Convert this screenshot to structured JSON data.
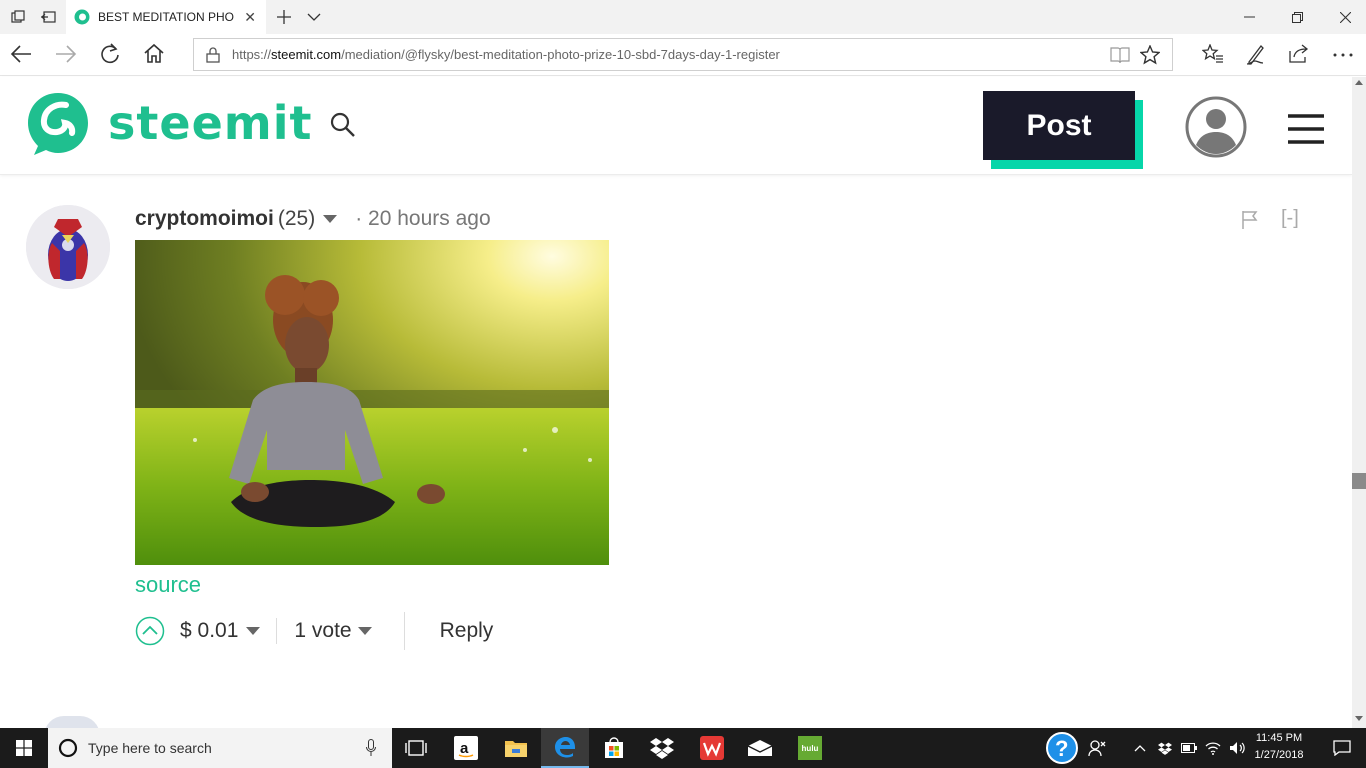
{
  "browser": {
    "tab_title": "BEST MEDITATION PHO",
    "url_prefix": "https://",
    "url_host": "steemit.com",
    "url_path": "/mediation/@flysky/best-meditation-photo-prize-10-sbd-7days-day-1-register"
  },
  "site": {
    "logo_text": "steemit",
    "post_label": "Post",
    "accent": "#1fbf8f",
    "post_shadow_color": "#06d6a9"
  },
  "comment": {
    "author": "cryptomoimoi",
    "reputation": "(25)",
    "time": "· 20 hours ago",
    "source_link": "source",
    "payout": "$ 0.01",
    "votes": "1 vote",
    "reply_label": "Reply",
    "collapse_label": "[-]"
  },
  "taskbar": {
    "search_placeholder": "Type here to search",
    "time": "11:45 PM",
    "date": "1/27/2018",
    "hulu_label": "hulu"
  }
}
